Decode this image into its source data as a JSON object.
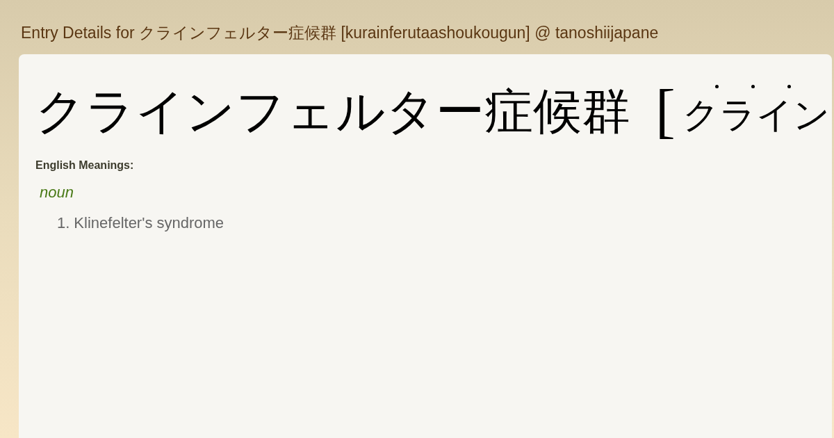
{
  "page_title": "Entry Details for クラインフェルター症候群 [kurainferutaashoukougun] @ tanoshiijapane",
  "entry": {
    "word": "クラインフェルター症候群",
    "bracket": "[",
    "reading": "クライン",
    "accent_dots": [
      {
        "shown": true
      },
      {
        "shown": true
      },
      {
        "shown": true
      }
    ]
  },
  "meanings_label": "English Meanings:",
  "senses": [
    {
      "part_of_speech": "noun",
      "meanings": [
        {
          "number": "1.",
          "text": "Klinefelter's syndrome"
        }
      ]
    }
  ]
}
